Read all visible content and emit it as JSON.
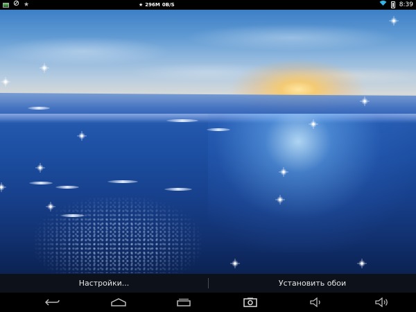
{
  "status_bar": {
    "left_icons": [
      "screenshot-notification-icon",
      "sync-icon",
      "star-icon"
    ],
    "center_icon": "star-icon",
    "memory": "296M",
    "network_speed": "0B/S",
    "right_icons": [
      "wifi-icon",
      "battery-icon"
    ],
    "time": "8:39"
  },
  "wallpaper": {
    "description_icon": "underwater-sunrise-wallpaper"
  },
  "action_bar": {
    "settings_label": "Настройки...",
    "set_wallpaper_label": "Установить обои"
  },
  "nav_bar": {
    "buttons": [
      {
        "name": "back-icon"
      },
      {
        "name": "home-icon"
      },
      {
        "name": "recent-apps-icon"
      },
      {
        "name": "screenshot-icon",
        "active": true
      },
      {
        "name": "volume-down-icon"
      },
      {
        "name": "volume-up-icon"
      }
    ]
  },
  "colors": {
    "status_bar_bg": "#000000",
    "nav_bar_bg": "#000000",
    "action_bar_bg": "#0f141e",
    "text": "#e6e6e6"
  }
}
